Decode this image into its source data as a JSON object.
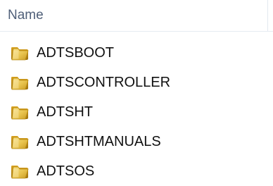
{
  "header": {
    "column_name": "Name"
  },
  "items": [
    {
      "label": "ADTSBOOT",
      "icon": "folder-icon"
    },
    {
      "label": "ADTSCONTROLLER",
      "icon": "folder-icon"
    },
    {
      "label": "ADTSHT",
      "icon": "folder-icon"
    },
    {
      "label": "ADTSHTMANUALS",
      "icon": "folder-icon"
    },
    {
      "label": "ADTSOS",
      "icon": "folder-icon"
    }
  ],
  "colors": {
    "header_text": "#4f5f78",
    "item_text": "#111111",
    "folder_yellow": "#e8c34d",
    "folder_dark": "#b98a12"
  }
}
